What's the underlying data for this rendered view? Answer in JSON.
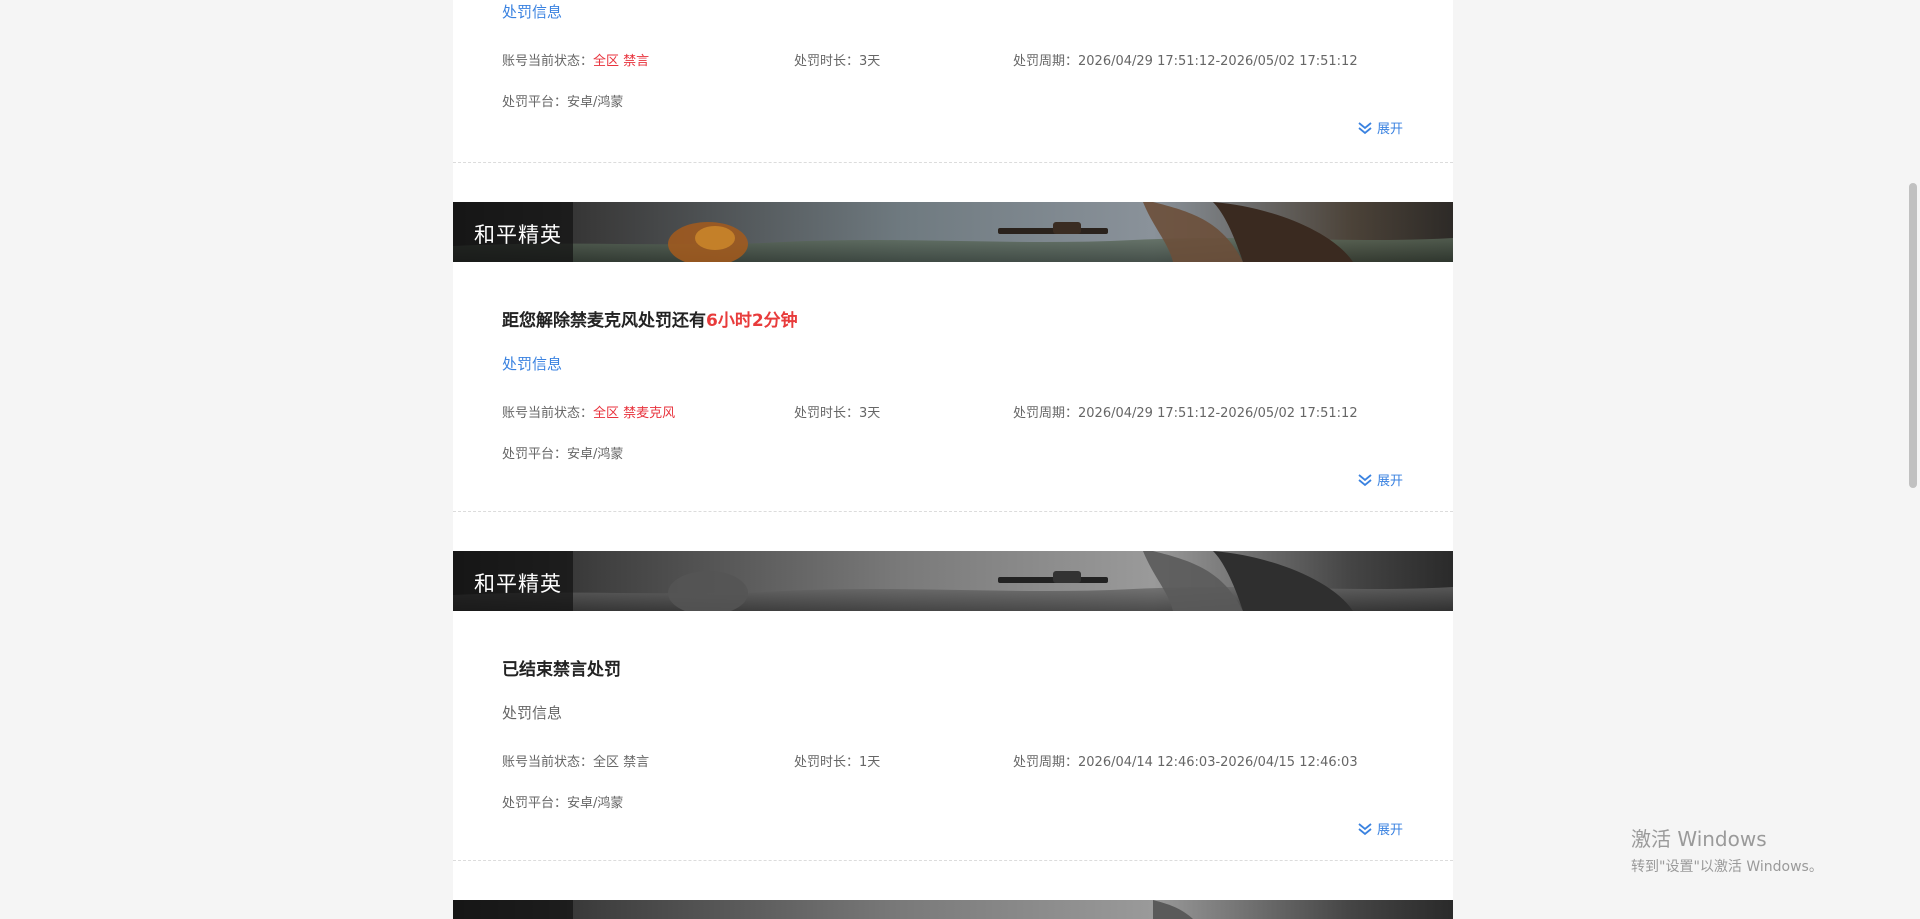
{
  "cards": [
    {
      "game": "",
      "headline_prefix": "",
      "headline_highlight": "",
      "section_label": "处罚信息",
      "status_label": "账号当前状态：",
      "status_value": "全区 禁言",
      "duration_label": "处罚时长：",
      "duration_value": "3天",
      "period_label": "处罚周期：",
      "period_value": "2026/04/29 17:51:12-2026/05/02 17:51:12",
      "platform_label": "处罚平台：",
      "platform_value": "安卓/鸿蒙",
      "expand_label": "展开",
      "active": true
    },
    {
      "game": "和平精英",
      "headline_prefix": "距您解除禁麦克风处罚还有",
      "headline_highlight": "6小时2分钟",
      "section_label": "处罚信息",
      "status_label": "账号当前状态：",
      "status_value": "全区 禁麦克风",
      "duration_label": "处罚时长：",
      "duration_value": "3天",
      "period_label": "处罚周期：",
      "period_value": "2026/04/29 17:51:12-2026/05/02 17:51:12",
      "platform_label": "处罚平台：",
      "platform_value": "安卓/鸿蒙",
      "expand_label": "展开",
      "active": true
    },
    {
      "game": "和平精英",
      "headline_prefix": "已结束禁言处罚",
      "headline_highlight": "",
      "section_label": "处罚信息",
      "status_label": "账号当前状态：",
      "status_value": "全区 禁言",
      "duration_label": "处罚时长：",
      "duration_value": "1天",
      "period_label": "处罚周期：",
      "period_value": "2026/04/14 12:46:03-2026/04/15 12:46:03",
      "platform_label": "处罚平台：",
      "platform_value": "安卓/鸿蒙",
      "expand_label": "展开",
      "active": false
    }
  ],
  "watermark": {
    "title": "激活 Windows",
    "subtitle": "转到\"设置\"以激活 Windows。"
  },
  "colors": {
    "accent": "#3a82e0",
    "alert": "#e8323c",
    "banner_active": "#2a2a2a",
    "banner_inactive": "#5a5a5a"
  },
  "icons": {
    "expand": "double-chevron-down-icon"
  }
}
